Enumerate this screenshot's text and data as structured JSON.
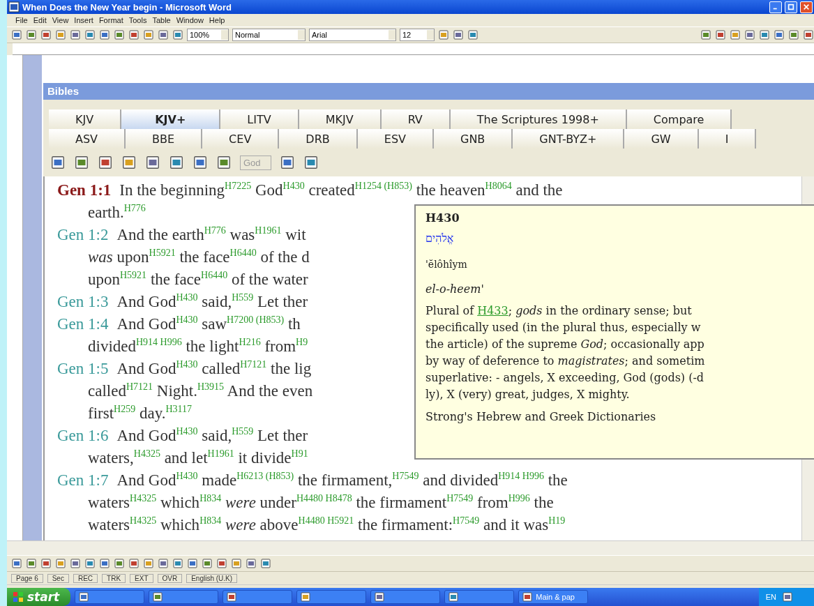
{
  "window": {
    "title": "When Does the New Year begin - Microsoft Word"
  },
  "menu_bar": [
    "File",
    "Edit",
    "View",
    "Insert",
    "Format",
    "Tools",
    "Table",
    "Window",
    "Help"
  ],
  "formatting_toolbar": {
    "zoom": "100%",
    "style": "Normal",
    "font": "Arial",
    "size": "12"
  },
  "bibles_panel": {
    "title": "Bibles",
    "tab_rows": [
      [
        {
          "label": "KJV",
          "selected": false
        },
        {
          "label": "KJV+",
          "selected": true
        },
        {
          "label": "LITV",
          "selected": false
        },
        {
          "label": "MKJV",
          "selected": false
        },
        {
          "label": "RV",
          "selected": false
        },
        {
          "label": "The Scriptures 1998+",
          "selected": false
        },
        {
          "label": "Compare",
          "selected": false
        }
      ],
      [
        {
          "label": "ASV",
          "selected": false
        },
        {
          "label": "BBE",
          "selected": false
        },
        {
          "label": "CEV",
          "selected": false
        },
        {
          "label": "DRB",
          "selected": false
        },
        {
          "label": "ESV",
          "selected": false
        },
        {
          "label": "GNB",
          "selected": false
        },
        {
          "label": "GNT-BYZ+",
          "selected": false
        },
        {
          "label": "GW",
          "selected": false
        },
        {
          "label": "I",
          "selected": false
        }
      ]
    ],
    "toolbar": {
      "filter": "God",
      "filter_disabled": true
    },
    "verses": [
      {
        "ref": "Gen 1:1",
        "selected": true,
        "lines": [
          "In the beginning$^{H7225}$ God$^{H430}$ created$^{H1254 (H853)}$ the heaven$^{H8064}$ and the",
          "earth.$^{H776}$"
        ]
      },
      {
        "ref": "Gen 1:2",
        "selected": false,
        "lines": [
          "And the earth$^{H776}$ was$^{H1961}$ wit",
          "*was* upon$^{H5921}$ the face$^{H6440}$ of the d",
          "upon$^{H5921}$ the face$^{H6440}$ of the water"
        ]
      },
      {
        "ref": "Gen 1:3",
        "selected": false,
        "lines": [
          "And God$^{H430}$ said,$^{H559}$ Let ther"
        ]
      },
      {
        "ref": "Gen 1:4",
        "selected": false,
        "lines": [
          "And God$^{H430}$ saw$^{H7200 (H853)}$ th",
          "divided$^{H914 H996}$ the light$^{H216}$ from$^{H9}$"
        ]
      },
      {
        "ref": "Gen 1:5",
        "selected": false,
        "lines": [
          "And God$^{H430}$ called$^{H7121}$ the lig",
          "called$^{H7121}$ Night.$^{H3915}$ And the even",
          "first$^{H259}$ day.$^{H3117}$"
        ]
      },
      {
        "ref": "Gen 1:6",
        "selected": false,
        "lines": [
          "And God$^{H430}$ said,$^{H559}$ Let ther",
          "waters,$^{H4325}$ and let$^{H1961}$ it divide$^{H91}$"
        ]
      },
      {
        "ref": "Gen 1:7",
        "selected": false,
        "lines": [
          "And God$^{H430}$ made$^{H6213 (H853)}$ the firmament,$^{H7549}$ and divided$^{H914 H996}$ the",
          "waters$^{H4325}$ which$^{H834}$ *were* under$^{H4480 H8478}$ the firmament$^{H7549}$ from$^{H996}$ the",
          "waters$^{H4325}$ which$^{H834}$ *were* above$^{H4480 H5921}$ the firmament:$^{H7549}$ and it was$^{H19}$"
        ]
      }
    ],
    "popup": {
      "title": "H430",
      "hebrew": "אֱלֹהִים",
      "transliteration": "'ĕlôhîym",
      "pronunciation": "el-o-heem'",
      "definition": {
        "before": "Plural of ",
        "link": "H433",
        "lines": [
          "; *gods* in the ordinary sense; but",
          "specifically used (in the plural thus, especially w",
          "the article) of the supreme *God*; occasionally app",
          "by way of deference to *magistrates*; and sometim",
          "superlative: - angels, X exceeding, God (gods) (-d",
          "ly), X (very) great, judges, X mighty."
        ]
      },
      "source": "Strong's Hebrew and Greek Dictionaries"
    }
  },
  "status_bar": [
    "Page 6",
    "Sec",
    "REC",
    "TRK",
    "EXT",
    "OVR",
    "English (U.K)"
  ],
  "taskbar": {
    "start": "start",
    "items": [
      "Main & pap"
    ],
    "language": "EN"
  }
}
